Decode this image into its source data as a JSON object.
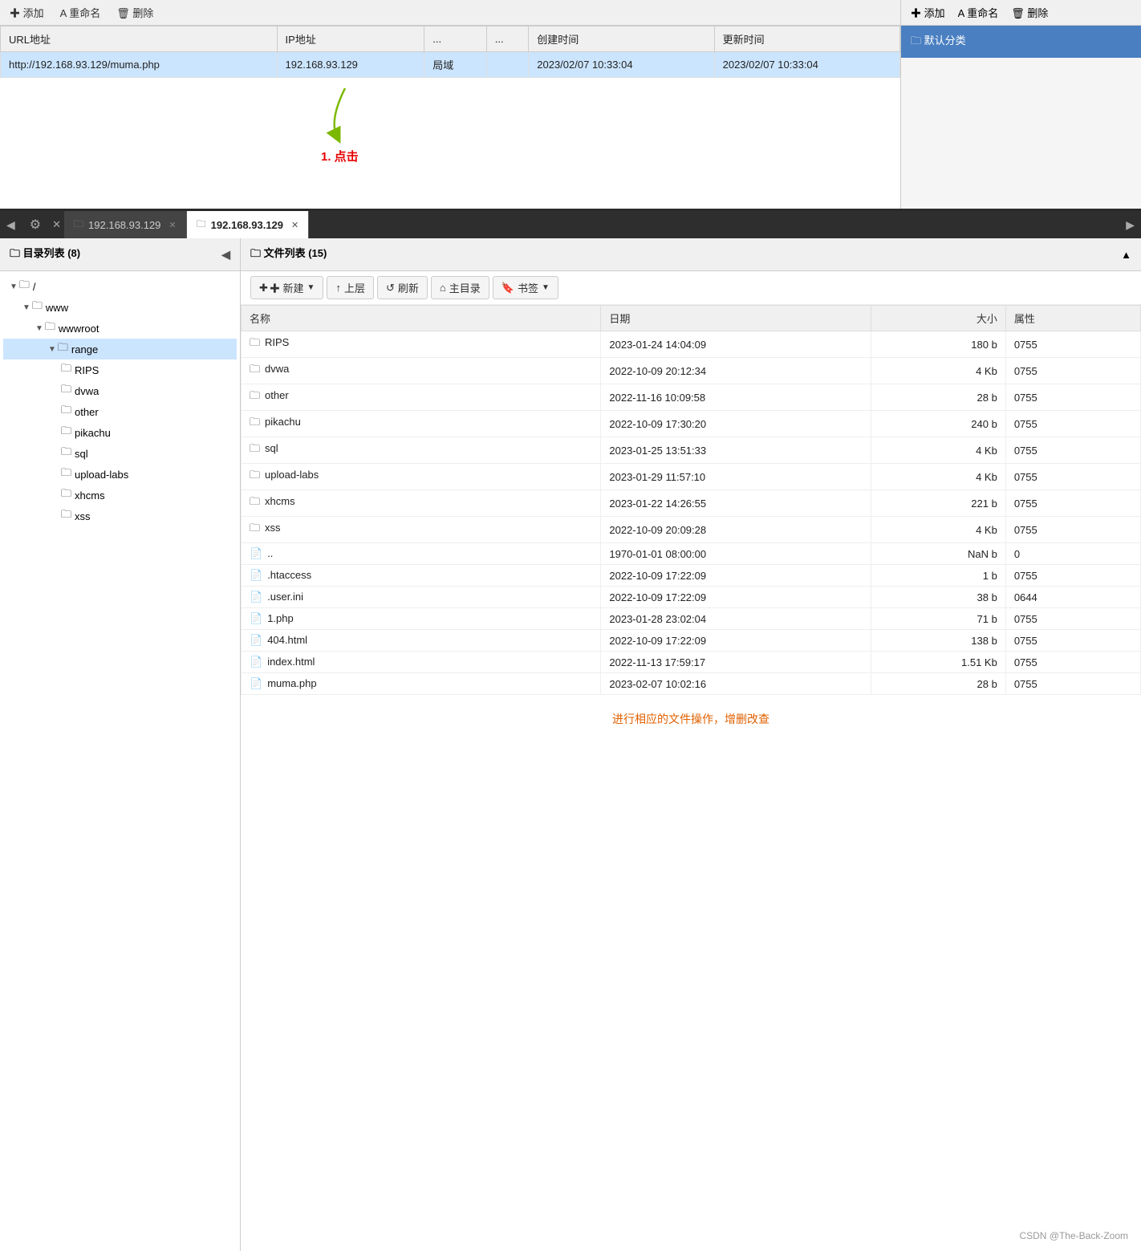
{
  "topPanel": {
    "columns": [
      "URL地址",
      "IP地址",
      "...",
      "...",
      "创建时间",
      "更新时间"
    ],
    "row": {
      "url": "http://192.168.93.129/muma.php",
      "ip": "192.168.93.129",
      "col3": "局域",
      "col4": "",
      "created": "2023/02/07 10:33:04",
      "updated": "2023/02/07 10:33:04"
    },
    "rightToolbar": {
      "add": "✚ 添加",
      "rename": "A 重命名",
      "delete": "🗑 删除"
    },
    "rightItem": "🗀 默认分类",
    "annotation": "1. 点击"
  },
  "tabBar": {
    "leftArrow": "◀",
    "rightArrow": "▶",
    "settingsIcon": "⚙",
    "tabs": [
      {
        "label": "🖥 192.168.93.129",
        "active": false,
        "closable": true
      },
      {
        "label": "🖥 192.168.93.129",
        "active": true,
        "closable": true
      }
    ]
  },
  "sidebar": {
    "title": "🗀 目录列表 (8)",
    "tree": [
      {
        "label": "/",
        "indent": 1,
        "type": "folder",
        "expanded": true
      },
      {
        "label": "www",
        "indent": 2,
        "type": "folder",
        "expanded": true
      },
      {
        "label": "wwwroot",
        "indent": 3,
        "type": "folder",
        "expanded": true
      },
      {
        "label": "range",
        "indent": 4,
        "type": "folder",
        "selected": true,
        "expanded": true
      },
      {
        "label": "RIPS",
        "indent": 5,
        "type": "folder"
      },
      {
        "label": "dvwa",
        "indent": 5,
        "type": "folder"
      },
      {
        "label": "other",
        "indent": 5,
        "type": "folder"
      },
      {
        "label": "pikachu",
        "indent": 5,
        "type": "folder"
      },
      {
        "label": "sql",
        "indent": 5,
        "type": "folder"
      },
      {
        "label": "upload-labs",
        "indent": 5,
        "type": "folder"
      },
      {
        "label": "xhcms",
        "indent": 5,
        "type": "folder"
      },
      {
        "label": "xss",
        "indent": 5,
        "type": "folder"
      }
    ]
  },
  "filePanel": {
    "title": "🗀 文件列表 (15)",
    "toolbar": {
      "newBtn": "✚ 新建",
      "upBtn": "↑ 上层",
      "refreshBtn": "↺ 刷新",
      "homeBtn": "⌂ 主目录",
      "bookmarkBtn": "🔖 书签"
    },
    "columns": [
      "名称",
      "日期",
      "大小",
      "属性"
    ],
    "files": [
      {
        "icon": "folder",
        "name": "RIPS",
        "date": "2023-01-24 14:04:09",
        "size": "180 b",
        "attr": "0755"
      },
      {
        "icon": "folder",
        "name": "dvwa",
        "date": "2022-10-09 20:12:34",
        "size": "4 Kb",
        "attr": "0755"
      },
      {
        "icon": "folder",
        "name": "other",
        "date": "2022-11-16 10:09:58",
        "size": "28 b",
        "attr": "0755"
      },
      {
        "icon": "folder",
        "name": "pikachu",
        "date": "2022-10-09 17:30:20",
        "size": "240 b",
        "attr": "0755"
      },
      {
        "icon": "folder",
        "name": "sql",
        "date": "2023-01-25 13:51:33",
        "size": "4 Kb",
        "attr": "0755"
      },
      {
        "icon": "folder",
        "name": "upload-labs",
        "date": "2023-01-29 11:57:10",
        "size": "4 Kb",
        "attr": "0755"
      },
      {
        "icon": "folder",
        "name": "xhcms",
        "date": "2023-01-22 14:26:55",
        "size": "221 b",
        "attr": "0755"
      },
      {
        "icon": "folder",
        "name": "xss",
        "date": "2022-10-09 20:09:28",
        "size": "4 Kb",
        "attr": "0755"
      },
      {
        "icon": "file",
        "name": "..",
        "date": "1970-01-01 08:00:00",
        "size": "NaN b",
        "attr": "0"
      },
      {
        "icon": "file",
        "name": ".htaccess",
        "date": "2022-10-09 17:22:09",
        "size": "1 b",
        "attr": "0755"
      },
      {
        "icon": "file",
        "name": ".user.ini",
        "date": "2022-10-09 17:22:09",
        "size": "38 b",
        "attr": "0644"
      },
      {
        "icon": "file",
        "name": "1.php",
        "date": "2023-01-28 23:02:04",
        "size": "71 b",
        "attr": "0755"
      },
      {
        "icon": "file",
        "name": "404.html",
        "date": "2022-10-09 17:22:09",
        "size": "138 b",
        "attr": "0755"
      },
      {
        "icon": "file",
        "name": "index.html",
        "date": "2022-11-13 17:59:17",
        "size": "1.51 Kb",
        "attr": "0755"
      },
      {
        "icon": "file",
        "name": "muma.php",
        "date": "2023-02-07 10:02:16",
        "size": "28 b",
        "attr": "0755"
      }
    ],
    "bottomNote": "进行相应的文件操作，增删改查"
  },
  "watermark": "CSDN @The-Back-Zoom"
}
